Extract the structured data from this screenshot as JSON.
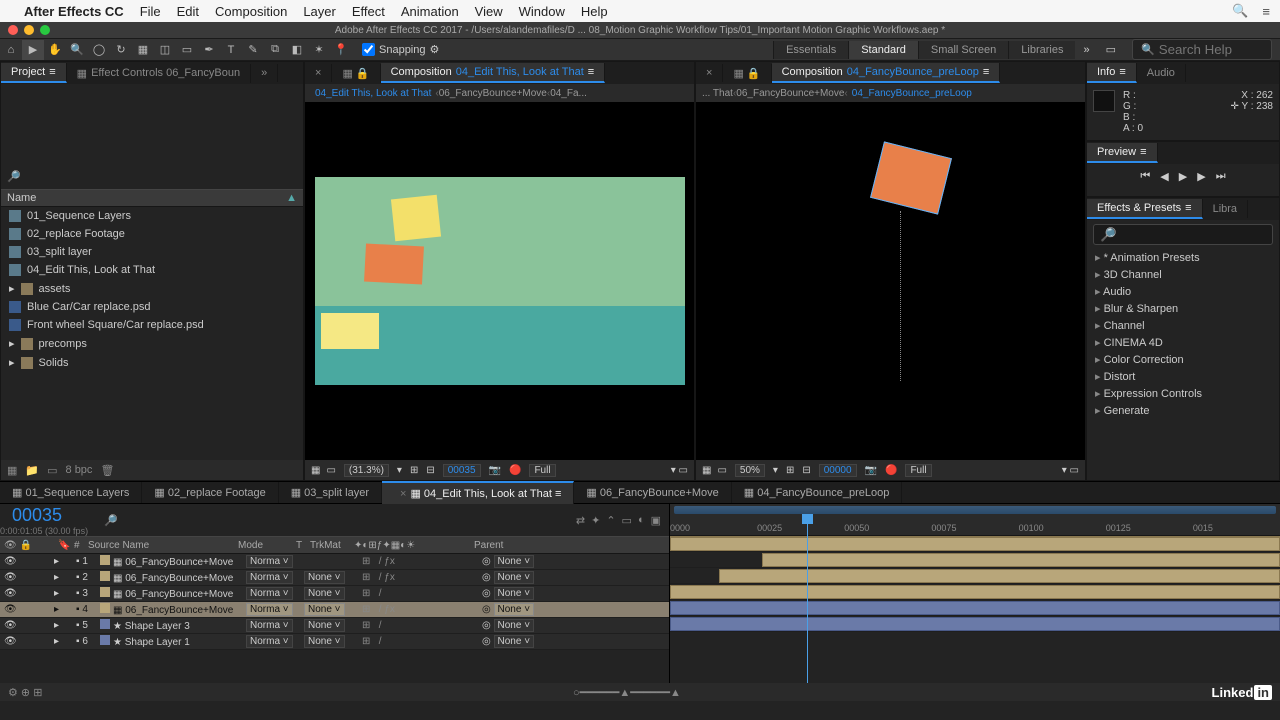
{
  "mac_menu": {
    "app": "After Effects CC",
    "items": [
      "File",
      "Edit",
      "Composition",
      "Layer",
      "Effect",
      "Animation",
      "View",
      "Window",
      "Help"
    ]
  },
  "titlebar": "Adobe After Effects CC 2017 - /Users/alandemafiles/D ... 08_Motion Graphic Workflow Tips/01_Important Motion Graphic Workflows.aep *",
  "toolbar": {
    "snapping_label": "Snapping"
  },
  "workspaces": {
    "tabs": [
      "Essentials",
      "Standard",
      "Small Screen",
      "Libraries"
    ],
    "active": 1,
    "search_placeholder": "Search Help"
  },
  "project": {
    "tab_project": "Project",
    "tab_effectcontrols": "Effect Controls 06_FancyBoun",
    "col_name": "Name",
    "items": [
      {
        "type": "comp",
        "label": "01_Sequence Layers"
      },
      {
        "type": "comp",
        "label": "02_replace Footage"
      },
      {
        "type": "comp",
        "label": "03_split layer"
      },
      {
        "type": "comp",
        "label": "04_Edit This, Look at That"
      },
      {
        "type": "folder",
        "label": "assets"
      },
      {
        "type": "psd",
        "label": "Blue Car/Car replace.psd"
      },
      {
        "type": "psd",
        "label": "Front wheel Square/Car replace.psd"
      },
      {
        "type": "folder",
        "label": "precomps"
      },
      {
        "type": "folder",
        "label": "Solids"
      }
    ],
    "footer_bpc": "8 bpc"
  },
  "comp_left": {
    "tab_prefix": "Composition",
    "tab_name": "04_Edit This, Look at That",
    "breadcrumb": [
      "04_Edit This, Look at That",
      "06_FancyBounce+Move",
      "04_Fa..."
    ],
    "mag": "(31.3%)",
    "time": "00035",
    "res": "Full"
  },
  "comp_right": {
    "tab_prefix": "Composition",
    "tab_name": "04_FancyBounce_preLoop",
    "breadcrumb": [
      "... That",
      "06_FancyBounce+Move",
      "04_FancyBounce_preLoop"
    ],
    "mag": "50%",
    "time": "00000",
    "res": "Full"
  },
  "info": {
    "tab_info": "Info",
    "tab_audio": "Audio",
    "R": "R :",
    "G": "G :",
    "B": "B :",
    "A": "A :  0",
    "X": "X : 262",
    "Y": "Y : 238"
  },
  "preview": {
    "tab": "Preview"
  },
  "effects_presets": {
    "tab_ep": "Effects & Presets",
    "tab_lib": "Libra",
    "items": [
      "* Animation Presets",
      "3D Channel",
      "Audio",
      "Blur & Sharpen",
      "Channel",
      "CINEMA 4D",
      "Color Correction",
      "Distort",
      "Expression Controls",
      "Generate"
    ]
  },
  "timeline": {
    "tabs": [
      {
        "label": "01_Sequence Layers"
      },
      {
        "label": "02_replace Footage"
      },
      {
        "label": "03_split layer"
      },
      {
        "label": "04_Edit This, Look at That",
        "active": true
      },
      {
        "label": "06_FancyBounce+Move"
      },
      {
        "label": "04_FancyBounce_preLoop"
      }
    ],
    "current_time": "00035",
    "fps": "0:00:01:05 (30.00 fps)",
    "cols": {
      "num": "#",
      "source": "Source Name",
      "mode": "Mode",
      "t": "T",
      "trkmat": "TrkMat",
      "parent": "Parent"
    },
    "layers": [
      {
        "n": "1",
        "name": "06_FancyBounce+Move",
        "mode": "Norma",
        "trk": "",
        "parent": "None",
        "color": "tan",
        "fx": true
      },
      {
        "n": "2",
        "name": "06_FancyBounce+Move",
        "mode": "Norma",
        "trk": "None",
        "parent": "None",
        "color": "tan",
        "fx": true
      },
      {
        "n": "3",
        "name": "06_FancyBounce+Move",
        "mode": "Norma",
        "trk": "None",
        "parent": "None",
        "color": "tan",
        "fx": false
      },
      {
        "n": "4",
        "name": "06_FancyBounce+Move",
        "mode": "Norma",
        "trk": "None",
        "parent": "None",
        "color": "tan",
        "fx": true,
        "sel": true
      },
      {
        "n": "5",
        "name": "Shape Layer 3",
        "mode": "Norma",
        "trk": "None",
        "parent": "None",
        "color": "blue",
        "fx": false,
        "star": true
      },
      {
        "n": "6",
        "name": "Shape Layer 1",
        "mode": "Norma",
        "trk": "None",
        "parent": "None",
        "color": "blue",
        "fx": false,
        "star": true
      }
    ],
    "ruler": [
      "0000",
      "00025",
      "00050",
      "00075",
      "00100",
      "00125",
      "0015"
    ]
  },
  "footer_brand": {
    "linked": "Linked",
    "in": "in"
  }
}
